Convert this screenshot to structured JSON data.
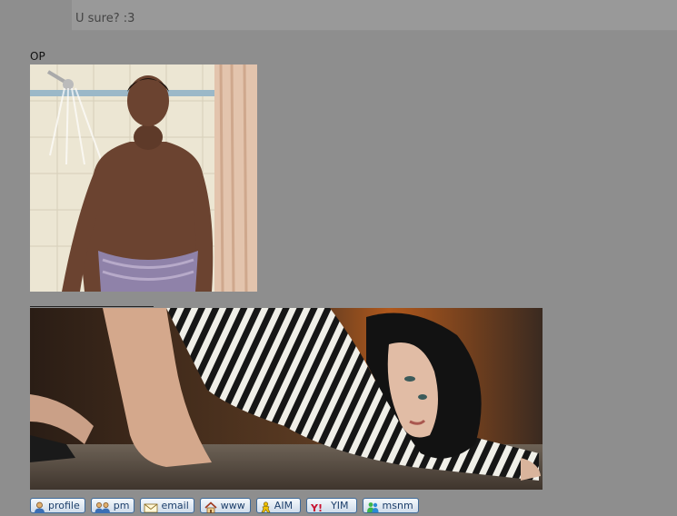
{
  "quote": {
    "text": "U sure? :3"
  },
  "post": {
    "op_label": "OP",
    "images": [
      {
        "name": "shower-man-image"
      },
      {
        "name": "striped-shirt-banner-image"
      }
    ]
  },
  "profile_buttons": [
    {
      "label": "profile",
      "icon": "user-icon"
    },
    {
      "label": "pm",
      "icon": "users-icon"
    },
    {
      "label": "email",
      "icon": "envelope-icon"
    },
    {
      "label": "www",
      "icon": "home-icon"
    },
    {
      "label": "AIM",
      "icon": "aim-icon"
    },
    {
      "label": "YIM",
      "icon": "yahoo-icon"
    },
    {
      "label": "msnm",
      "icon": "msn-icon"
    }
  ],
  "colors": {
    "background": "#8e8e8e",
    "quote_strip": "#999999",
    "button_border": "#3e6a9a",
    "button_text": "#1d3f6b"
  }
}
